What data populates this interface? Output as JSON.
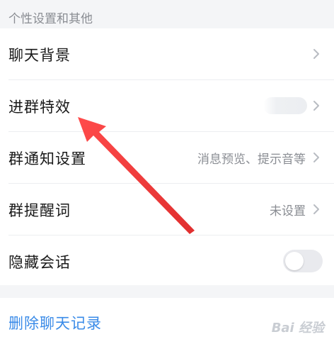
{
  "section": {
    "header": "个性设置和其他"
  },
  "settings": {
    "items": [
      {
        "label": "聊天背景",
        "value": ""
      },
      {
        "label": "进群特效",
        "value": ""
      },
      {
        "label": "群通知设置",
        "value": "消息预览、提示音等"
      },
      {
        "label": "群提醒词",
        "value": "未设置"
      },
      {
        "label": "隐藏会话",
        "value": ""
      }
    ]
  },
  "toggles": {
    "hide_chat": {
      "on": false
    }
  },
  "actions": {
    "delete_chat": "删除聊天记录"
  },
  "watermark": {
    "text": "Bai 经验"
  },
  "colors": {
    "accent_link": "#3a8be8",
    "annotation_arrow": "#ea3b3b",
    "background": "#f4f5f7"
  },
  "icons": {
    "chevron": "chevron-right-icon",
    "annotation": "red-arrow-annotation"
  }
}
